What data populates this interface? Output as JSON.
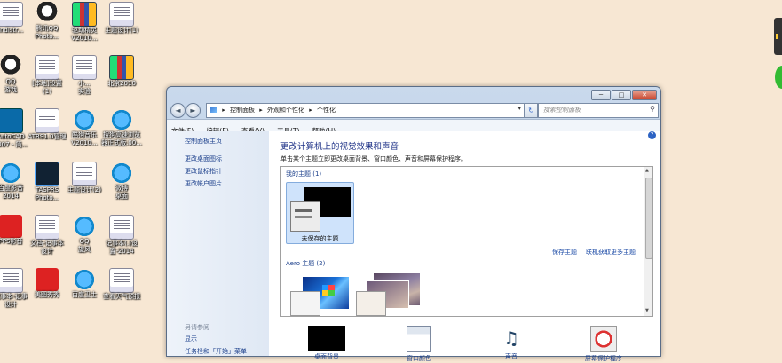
{
  "desktop": {
    "icons": [
      {
        "label": "Indistr...",
        "type": "doc"
      },
      {
        "label": "腾讯QQ\nPhoto...",
        "type": "qq"
      },
      {
        "label": "驱动精灵\nV2010...",
        "type": "zip"
      },
      {
        "label": "主题设计(1)",
        "type": "doc"
      },
      {
        "label": "QQ\n游戏",
        "type": "qq"
      },
      {
        "label": "[本地]设置\n(1)",
        "type": "doc"
      },
      {
        "label": "小...\n实验",
        "type": "doc"
      },
      {
        "label": "北京2010",
        "type": "zip"
      },
      {
        "label": "AutoCAD\n2007 - 简...",
        "type": "cad"
      },
      {
        "label": "ATRS1.0管理",
        "type": "doc"
      },
      {
        "label": "酷狗音乐\nV2010...",
        "type": "blue"
      },
      {
        "label": "搜狗高速浏览\n器正式版.00...",
        "type": "blue"
      },
      {
        "label": "百度影音\n2014",
        "type": "blue"
      },
      {
        "label": "TASPRS\nPhoto...",
        "type": "ps"
      },
      {
        "label": "主题设计(2)",
        "type": "doc"
      },
      {
        "label": "微博\n桌面",
        "type": "blue"
      },
      {
        "label": "PPS影音",
        "type": "red"
      },
      {
        "label": "文档-记事本\n设计",
        "type": "doc"
      },
      {
        "label": "QQ\n旋风",
        "type": "blue"
      },
      {
        "label": "记事本(.)设\n置-2014",
        "type": "doc"
      },
      {
        "label": "记事本-记事\n设计",
        "type": "doc"
      },
      {
        "label": "美图秀秀",
        "type": "red"
      },
      {
        "label": "百度卫士",
        "type": "blue"
      },
      {
        "label": "查看天气预报",
        "type": "doc"
      }
    ]
  },
  "window": {
    "caption_buttons": [
      "─",
      "□",
      "✕"
    ],
    "nav": {
      "back": "◄",
      "forward": "►"
    },
    "address": {
      "crumbs": [
        "控制面板",
        "外观和个性化",
        "个性化"
      ],
      "separator": "▸"
    },
    "search_placeholder": "搜索控制面板",
    "menu": [
      "文件(F)",
      "编辑(E)",
      "查看(V)",
      "工具(T)",
      "帮助(H)"
    ],
    "left_pane": {
      "home_link": "控制面板主页",
      "links": [
        "更改桌面图标",
        "更改鼠标指针",
        "更改帐户图片"
      ],
      "see_also": "另请参阅",
      "see_also_links": [
        "显示",
        "任务栏和「开始」菜单"
      ]
    },
    "help_icon": "?",
    "main": {
      "title": "更改计算机上的视觉效果和声音",
      "description": "单击某个主题立即更改桌面背景、窗口颜色、声音和屏幕保护程序。",
      "my_themes_header": "我的主题 (1)",
      "unsaved_theme_label": "未保存的主题",
      "save_theme_link": "保存主题",
      "get_more_link": "联机获取更多主题",
      "aero_header": "Aero 主题 (2)"
    },
    "bottom_items": [
      {
        "label": "桌面背景",
        "icon": "desktop-background-icon"
      },
      {
        "label": "窗口颜色",
        "icon": "window-color-icon"
      },
      {
        "label": "声音",
        "icon": "sounds-icon"
      },
      {
        "label": "屏幕保护程序",
        "icon": "screen-saver-icon"
      }
    ]
  }
}
